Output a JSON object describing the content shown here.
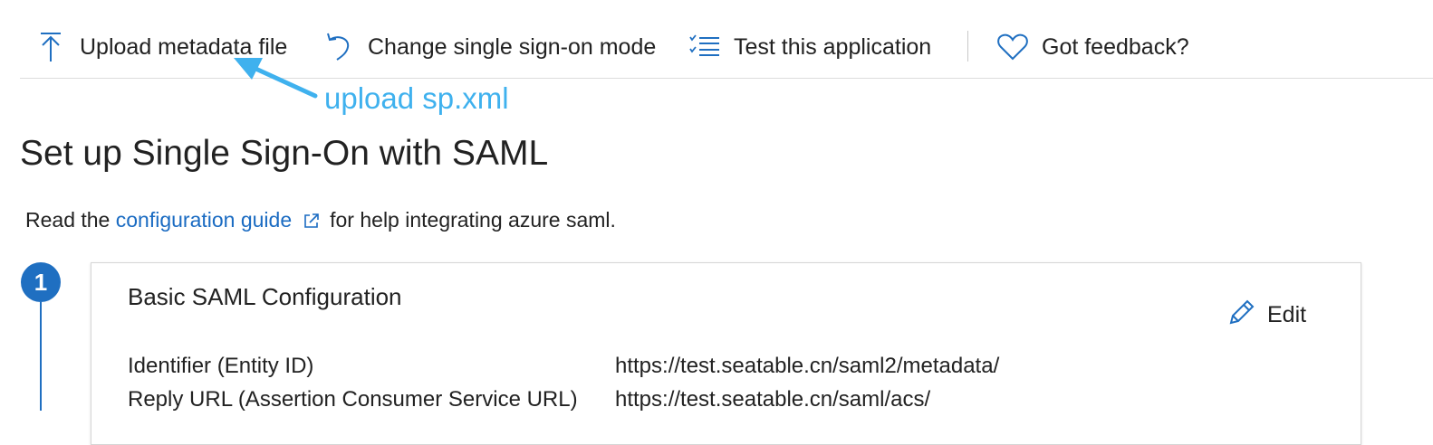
{
  "toolbar": {
    "items": [
      {
        "label": "Upload metadata file",
        "icon": "upload-icon"
      },
      {
        "label": "Change single sign-on mode",
        "icon": "undo-icon"
      },
      {
        "label": "Test this application",
        "icon": "checklist-icon"
      },
      {
        "label": "Got feedback?",
        "icon": "heart-icon"
      }
    ]
  },
  "annotation": {
    "text": "upload sp.xml",
    "color": "#3fb1ee"
  },
  "page": {
    "title": "Set up Single Sign-On with SAML"
  },
  "help": {
    "prefix": "Read the",
    "link": "configuration guide",
    "suffix": "for help integrating azure saml."
  },
  "step": {
    "number": "1",
    "card_title": "Basic SAML Configuration",
    "edit_label": "Edit",
    "rows": [
      {
        "label": "Identifier (Entity ID)",
        "value": "https://test.seatable.cn/saml2/metadata/"
      },
      {
        "label": "Reply URL (Assertion Consumer Service URL)",
        "value": "https://test.seatable.cn/saml/acs/"
      }
    ]
  },
  "colors": {
    "accent": "#1f6fc1",
    "link": "#1a6bc2"
  }
}
